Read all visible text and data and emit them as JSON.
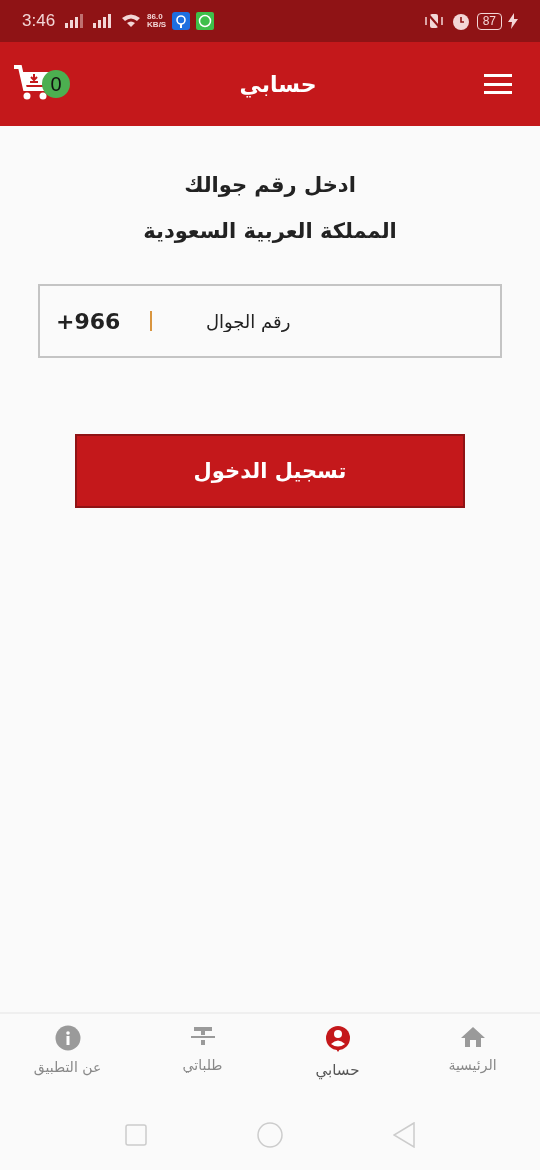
{
  "status_bar": {
    "time": "3:46",
    "speed_value": "86.0",
    "speed_unit": "KB/S",
    "battery": "87"
  },
  "header": {
    "title": "حسابي",
    "cart_count": "0"
  },
  "login": {
    "heading": "ادخل رقم جوالك",
    "country": "المملكة العربية السعودية",
    "country_code": "+966",
    "phone_placeholder": "رقم الجوال",
    "submit": "تسجيل الدخول"
  },
  "bottom_nav": [
    {
      "kind": "home",
      "label": "الرئيسية",
      "selected": false
    },
    {
      "kind": "account",
      "label": "حسابي",
      "selected": true
    },
    {
      "kind": "orders",
      "label": "طلباتي",
      "selected": false
    },
    {
      "kind": "info",
      "label": "عن التطبيق",
      "selected": false
    }
  ]
}
